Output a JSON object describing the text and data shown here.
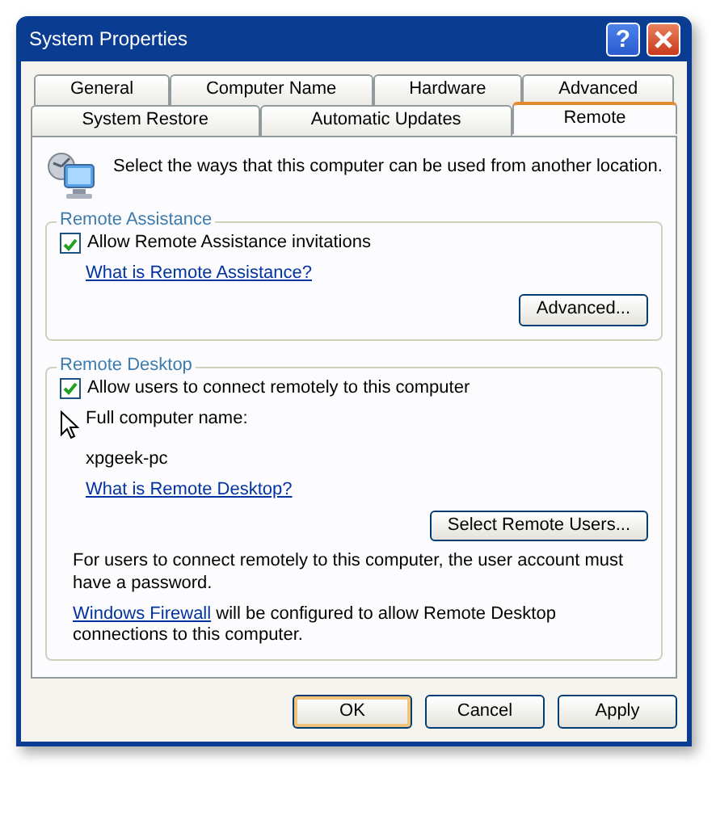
{
  "window": {
    "title": "System Properties",
    "help_button": "?"
  },
  "tab_rows": [
    [
      {
        "label": "General",
        "selected": false
      },
      {
        "label": "Computer Name",
        "selected": false
      },
      {
        "label": "Hardware",
        "selected": false
      },
      {
        "label": "Advanced",
        "selected": false
      }
    ],
    [
      {
        "label": "System Restore",
        "selected": false
      },
      {
        "label": "Automatic Updates",
        "selected": false
      },
      {
        "label": "Remote",
        "selected": true
      }
    ]
  ],
  "intro": "Select the ways that this computer can be used from another location.",
  "remote_assistance": {
    "title": "Remote Assistance",
    "checkbox": {
      "label": "Allow Remote Assistance invitations",
      "checked": true
    },
    "link": "What is Remote Assistance?",
    "button": "Advanced..."
  },
  "remote_desktop": {
    "title": "Remote Desktop",
    "checkbox": {
      "label": "Allow users to connect remotely to this computer",
      "checked": true
    },
    "computer_name_label": "Full computer name:",
    "computer_name": "xpgeek-pc",
    "link": "What is Remote Desktop?",
    "button": "Select Remote Users...",
    "password_note": "For users to connect remotely to this computer, the user account must have a password.",
    "firewall_link": "Windows Firewall",
    "firewall_note": "will be configured to allow Remote Desktop connections to this computer."
  },
  "buttons": [
    {
      "label": "OK",
      "default": true
    },
    {
      "label": "Cancel",
      "default": false
    },
    {
      "label": "Apply",
      "default": false
    }
  ]
}
